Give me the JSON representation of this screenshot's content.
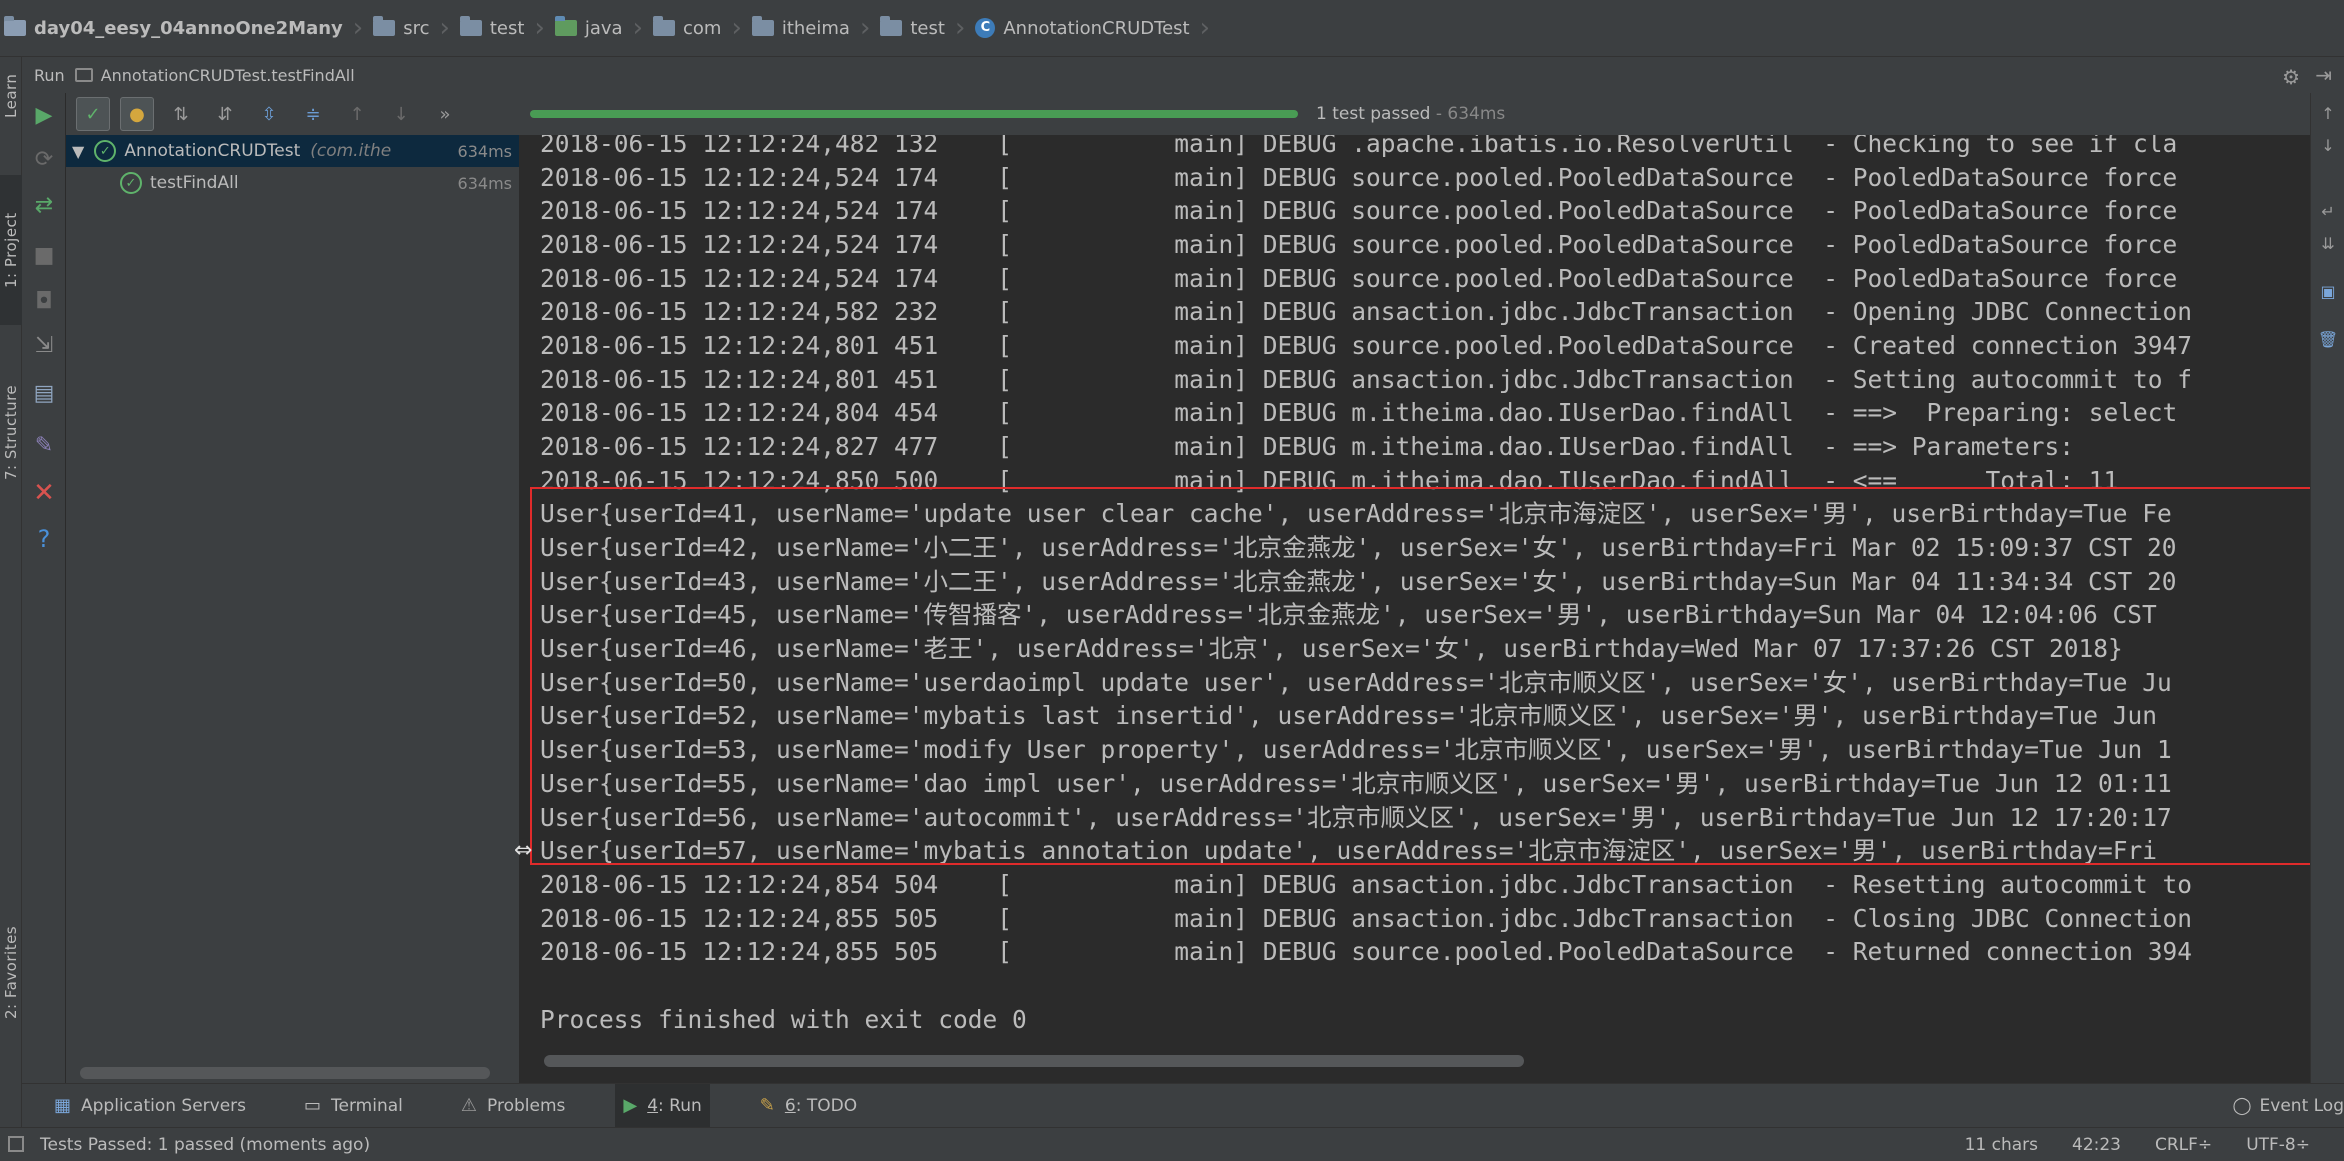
{
  "breadcrumb": [
    {
      "label": "day04_eesy_04annoOne2Many",
      "icon": "project-folder-icon"
    },
    {
      "label": "src",
      "icon": "folder-icon"
    },
    {
      "label": "test",
      "icon": "folder-icon"
    },
    {
      "label": "java",
      "icon": "source-folder-icon"
    },
    {
      "label": "com",
      "icon": "package-icon"
    },
    {
      "label": "itheima",
      "icon": "package-icon"
    },
    {
      "label": "test",
      "icon": "package-icon"
    },
    {
      "label": "AnnotationCRUDTest",
      "icon": "class-icon"
    }
  ],
  "left_stripe": {
    "learn": "Learn",
    "project": "1: Project",
    "structure": "7: Structure",
    "favorites": "2: Favorites"
  },
  "run_header": {
    "label": "Run",
    "config": "AnnotationCRUDTest.testFindAll"
  },
  "progress": {
    "fraction": 1.0,
    "status": "1 test passed",
    "time": " - 634ms"
  },
  "test_tree": [
    {
      "name": "AnnotationCRUDTest",
      "pkg": "(com.ithe",
      "time": "634ms",
      "selected": true
    },
    {
      "name": "testFindAll",
      "pkg": "",
      "time": "634ms",
      "selected": false
    }
  ],
  "console_lines": [
    "2018-06-15 12:12:24,482 132    [           main] DEBUG .apache.ibatis.io.ResolverUtil  - Checking to see if cla",
    "2018-06-15 12:12:24,524 174    [           main] DEBUG source.pooled.PooledDataSource  - PooledDataSource force",
    "2018-06-15 12:12:24,524 174    [           main] DEBUG source.pooled.PooledDataSource  - PooledDataSource force",
    "2018-06-15 12:12:24,524 174    [           main] DEBUG source.pooled.PooledDataSource  - PooledDataSource force",
    "2018-06-15 12:12:24,524 174    [           main] DEBUG source.pooled.PooledDataSource  - PooledDataSource force",
    "2018-06-15 12:12:24,582 232    [           main] DEBUG ansaction.jdbc.JdbcTransaction  - Opening JDBC Connection",
    "2018-06-15 12:12:24,801 451    [           main] DEBUG source.pooled.PooledDataSource  - Created connection 3947",
    "2018-06-15 12:12:24,801 451    [           main] DEBUG ansaction.jdbc.JdbcTransaction  - Setting autocommit to f",
    "2018-06-15 12:12:24,804 454    [           main] DEBUG m.itheima.dao.IUserDao.findAll  - ==>  Preparing: select",
    "2018-06-15 12:12:24,827 477    [           main] DEBUG m.itheima.dao.IUserDao.findAll  - ==> Parameters:",
    "2018-06-15 12:12:24,850 500    [           main] DEBUG m.itheima.dao.IUserDao.findAll  - <==      Total: 11",
    "User{userId=41, userName='update user clear cache', userAddress='北京市海淀区', userSex='男', userBirthday=Tue Fe",
    "User{userId=42, userName='小二王', userAddress='北京金燕龙', userSex='女', userBirthday=Fri Mar 02 15:09:37 CST 20",
    "User{userId=43, userName='小二王', userAddress='北京金燕龙', userSex='女', userBirthday=Sun Mar 04 11:34:34 CST 20",
    "User{userId=45, userName='传智播客', userAddress='北京金燕龙', userSex='男', userBirthday=Sun Mar 04 12:04:06 CST",
    "User{userId=46, userName='老王', userAddress='北京', userSex='女', userBirthday=Wed Mar 07 17:37:26 CST 2018}",
    "User{userId=50, userName='userdaoimpl update user', userAddress='北京市顺义区', userSex='女', userBirthday=Tue Ju",
    "User{userId=52, userName='mybatis last insertid', userAddress='北京市顺义区', userSex='男', userBirthday=Tue Jun",
    "User{userId=53, userName='modify User property', userAddress='北京市顺义区', userSex='男', userBirthday=Tue Jun 1",
    "User{userId=55, userName='dao impl user', userAddress='北京市顺义区', userSex='男', userBirthday=Tue Jun 12 01:11",
    "User{userId=56, userName='autocommit', userAddress='北京市顺义区', userSex='男', userBirthday=Tue Jun 12 17:20:17",
    "User{userId=57, userName='mybatis annotation update', userAddress='北京市海淀区', userSex='男', userBirthday=Fri",
    "2018-06-15 12:12:24,854 504    [           main] DEBUG ansaction.jdbc.JdbcTransaction  - Resetting autocommit to",
    "2018-06-15 12:12:24,855 505    [           main] DEBUG ansaction.jdbc.JdbcTransaction  - Closing JDBC Connection",
    "2018-06-15 12:12:24,855 505    [           main] DEBUG source.pooled.PooledDataSource  - Returned connection 394",
    "",
    "Process finished with exit code 0"
  ],
  "tool_tabs": [
    {
      "num": "",
      "label": "Application Servers",
      "icon": "server-icon"
    },
    {
      "num": "",
      "label": "Terminal",
      "icon": "terminal-icon"
    },
    {
      "num": "",
      "label": "Problems",
      "icon": "warning-icon"
    },
    {
      "num": "4",
      "label": ": Run",
      "icon": "run-icon",
      "active": true
    },
    {
      "num": "6",
      "label": ": TODO",
      "icon": "todo-icon"
    }
  ],
  "event_log": "Event Log",
  "status": {
    "message": "Tests Passed: 1 passed (moments ago)",
    "chars": "11 chars",
    "position": "42:23",
    "line_sep": "CRLF÷",
    "encoding": "UTF-8÷"
  },
  "colors": {
    "pass": "#5fb36b",
    "progress": "#499c54",
    "highlight": "#e02b2b",
    "panel": "#3c3f41",
    "console_bg": "#2b2b2b"
  }
}
